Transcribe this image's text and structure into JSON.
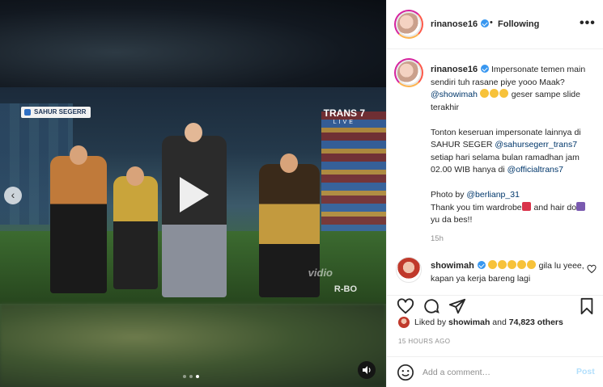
{
  "media": {
    "overlay_badge": "SAHUR SEGERR",
    "channel_logo": "TRANS 7",
    "channel_live": "LIVE",
    "watermark": "vidio",
    "watermark2": "R-BO",
    "carousel_dots": 3,
    "carousel_active_index": 2,
    "icons": {
      "play": "play-icon",
      "prev": "chevron-left-icon",
      "mute": "speaker-icon"
    }
  },
  "post_header": {
    "username": "rinanose16",
    "separator": "•",
    "follow_status": "Following",
    "more": "•••"
  },
  "caption": {
    "username": "rinanose16",
    "p1_text1": "Impersonate temen main sendiri tuh rasane piye yooo Maak? ",
    "p1_mention": "@showimah",
    "p1_text2": " geser sampe slide terakhir",
    "p2_text1": "Tonton keseruan impersonate lainnya di SAHUR SEGER ",
    "p2_mention1": "@sahursegerr_trans7",
    "p2_text2": " setiap hari selama bulan ramadhan jam 02.00 WIB hanya di ",
    "p2_mention2": "@officialtrans7",
    "p3_text1": "Photo by ",
    "p3_mention": "@berlianp_31",
    "p3_text2": "Thank you tim wardrobe",
    "p3_text3": " and hair do",
    "p3_text4": " yu da bes!!",
    "age": "15h"
  },
  "comment": {
    "username": "showimah",
    "text": " gila lu yeee, kapan ya kerja bareng lagi"
  },
  "likes": {
    "prefix": "Liked by ",
    "user": "showimah",
    "middle": " and ",
    "count": "74,823 others"
  },
  "timestamp": "15 HOURS AGO",
  "add_comment": {
    "placeholder": "Add a comment…",
    "post_label": "Post"
  },
  "colors": {
    "link": "#00376b",
    "verified": "#3897f0",
    "post_disabled": "#b2dffc"
  }
}
